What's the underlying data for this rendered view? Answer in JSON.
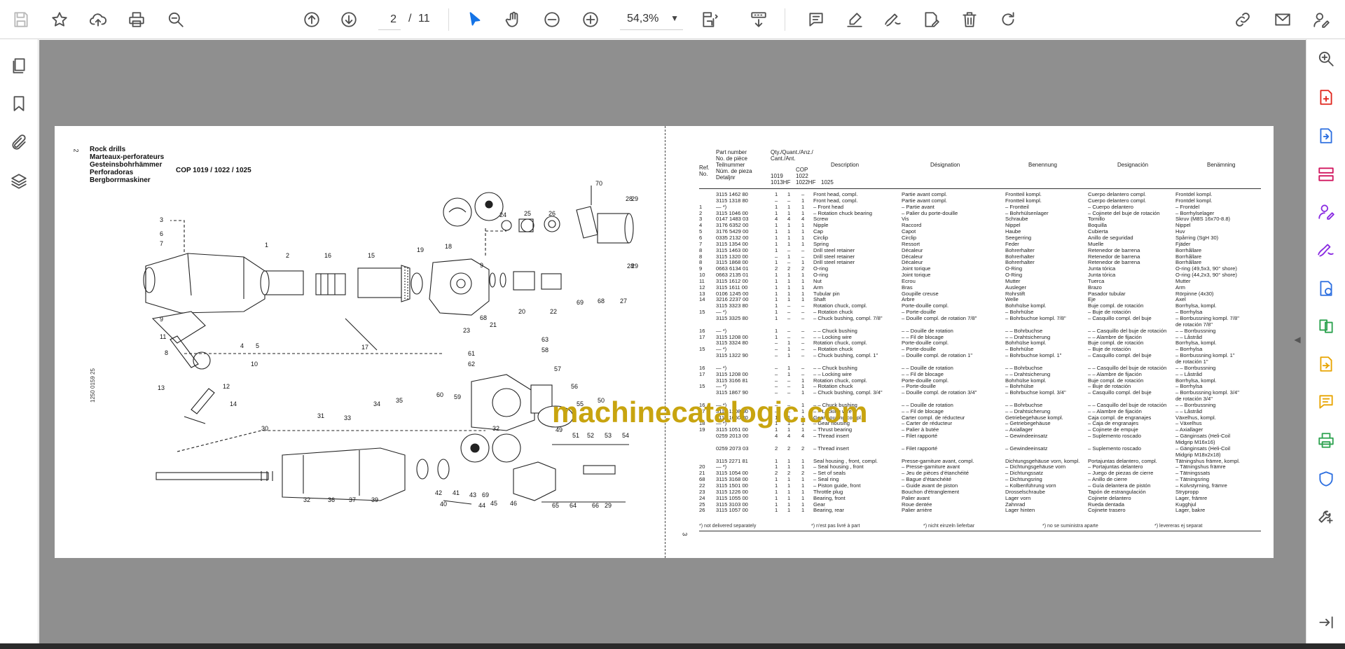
{
  "toolbar": {
    "page_current": "2",
    "page_separator": "/",
    "page_total": "11",
    "zoom": "54,3%",
    "icons": [
      "save-icon",
      "star-icon",
      "upload-icon",
      "print-icon",
      "search-icon",
      "page-up-icon",
      "page-down-icon",
      "select-cursor-icon",
      "hand-tool-icon",
      "zoom-out-icon",
      "zoom-in-icon",
      "page-fit-icon",
      "scroll-mode-icon",
      "comment-icon",
      "highlight-icon",
      "draw-icon",
      "edit-text-icon",
      "delete-icon",
      "redo-icon",
      "share-link-icon",
      "mail-icon",
      "sign-icon"
    ]
  },
  "left_rail": {
    "icons": [
      "pages-icon",
      "bookmark-icon",
      "attachment-icon",
      "layers-icon"
    ]
  },
  "right_rail": {
    "icons": [
      "zoom-search-icon",
      "create-pdf-icon",
      "export-pdf-icon",
      "organize-pages-icon",
      "fill-sign-icon",
      "edit-pdf-icon",
      "convert-icon",
      "compare-icon",
      "export-file-icon",
      "comment-icon",
      "print-production-icon",
      "protect-icon",
      "more-tools-icon",
      "expand-icon"
    ]
  },
  "colors": {
    "accent": "#1473e6",
    "watermark": "#c8a40f",
    "viewer_bg": "#8f8f8f"
  },
  "document": {
    "left_page_number": "2",
    "right_page_number": "3",
    "headings": [
      "Rock drills",
      "Marteaux-perforateurs",
      "Gesteinsbohrhämmer",
      "Perforadoras",
      "Bergborrmaskiner"
    ],
    "model_title": "COP 1019 / 1022 / 1025",
    "figure_code": "1250 0159 25",
    "diagram_labels": [
      "70",
      "28",
      "29",
      "24",
      "25",
      "26",
      "3",
      "6",
      "7",
      "1",
      "2",
      "16",
      "15",
      "19",
      "18",
      "9",
      "68",
      "21",
      "69",
      "68",
      "27",
      "28",
      "29",
      "9",
      "11",
      "4",
      "5",
      "8",
      "10",
      "17",
      "20",
      "22",
      "23",
      "63",
      "61",
      "62",
      "58",
      "57",
      "13",
      "12",
      "14",
      "60",
      "59",
      "56",
      "55",
      "50",
      "31",
      "33",
      "34",
      "35",
      "30",
      "49",
      "51",
      "52",
      "53",
      "54",
      "32",
      "36",
      "37",
      "39",
      "42",
      "41",
      "43",
      "69",
      "44",
      "45",
      "46",
      "65",
      "64",
      "66",
      "29",
      "40",
      "39",
      "38",
      "48",
      "47",
      "67"
    ],
    "watermark": "machinecatalogic.com",
    "table_headers": {
      "ref": "Ref.\nNo.",
      "part": "Part number\nNo. de pièce\nTeilnummer\nNúm. de pieza\nDetaljnr",
      "qty": "Qty./Quant./Anz./\nCant./Ant.",
      "cop": "COP",
      "m1": "1019\n1013HF",
      "m2": "1022\n1022HF",
      "m3": "1025",
      "en": "Description",
      "fr": "Désignation",
      "de": "Benennung",
      "es": "Designación",
      "sv": "Benämning"
    },
    "rows": [
      {
        "ref": "",
        "part": "3115 1462 80",
        "q": [
          "1",
          "1",
          "–"
        ],
        "en": "Front head, compl.",
        "fr": "Partie avant compl.",
        "de": "Frontteil kompl.",
        "es": "Cuerpo delantero compl.",
        "sv": "Frontdel kompl."
      },
      {
        "ref": "",
        "part": "3115 1318 80",
        "q": [
          "–",
          "–",
          "1"
        ],
        "en": "Front head, compl.",
        "fr": "Partie avant compl.",
        "de": "Frontteil kompl.",
        "es": "Cuerpo delantero compl.",
        "sv": "Frontdel kompl."
      },
      {
        "ref": "1",
        "part": "— *)",
        "q": [
          "1",
          "1",
          "1"
        ],
        "en": "– Front head",
        "fr": "– Partie avant",
        "de": "– Frontteil",
        "es": "– Cuerpo delantero",
        "sv": "– Frontdel"
      },
      {
        "ref": "2",
        "part": "3115 1046 00",
        "q": [
          "1",
          "1",
          "1"
        ],
        "en": "– Rotation chuck bearing",
        "fr": "– Palier du porte-douille",
        "de": "– Bohrhülsenlager",
        "es": "– Cojinete del buje de rotación",
        "sv": "– Borrhylselager"
      },
      {
        "ref": "3",
        "part": "0147 1483 03",
        "q": [
          "4",
          "4",
          "4"
        ],
        "en": "Screw",
        "fr": "Vis",
        "de": "Schraube",
        "es": "Tornillo",
        "sv": "Skruv (M8S 16x70-8.8)"
      },
      {
        "ref": "4",
        "part": "3176 6352 00",
        "q": [
          "1",
          "1",
          "1"
        ],
        "en": "Nipple",
        "fr": "Raccord",
        "de": "Nippel",
        "es": "Boquilla",
        "sv": "Nippel"
      },
      {
        "ref": "5",
        "part": "3176 5429 00",
        "q": [
          "1",
          "1",
          "1"
        ],
        "en": "Cap",
        "fr": "Capot",
        "de": "Haube",
        "es": "Cubierta",
        "sv": "Huv"
      },
      {
        "ref": "6",
        "part": "0335 2132 00",
        "q": [
          "1",
          "1",
          "1"
        ],
        "en": "Circlip",
        "fr": "Circlip",
        "de": "Seegerring",
        "es": "Anillo de seguridad",
        "sv": "Spårring (SgH 30)"
      },
      {
        "ref": "7",
        "part": "3115 1354 00",
        "q": [
          "1",
          "1",
          "1"
        ],
        "en": "Spring",
        "fr": "Ressort",
        "de": "Feder",
        "es": "Muelle",
        "sv": "Fjäder"
      },
      {
        "ref": "8",
        "part": "3115 1463 00",
        "q": [
          "1",
          "–",
          "–"
        ],
        "en": "Drill steel retainer",
        "fr": "Décaleur",
        "de": "Bohrerhalter",
        "es": "Retenedor de barrena",
        "sv": "Borrhållare"
      },
      {
        "ref": "8",
        "part": "3115 1320 00",
        "q": [
          "–",
          "1",
          "–"
        ],
        "en": "Drill steel retainer",
        "fr": "Décaleur",
        "de": "Bohrerhalter",
        "es": "Retenedor de barrena",
        "sv": "Borrhållare"
      },
      {
        "ref": "8",
        "part": "3115 1868 00",
        "q": [
          "1",
          "–",
          "1"
        ],
        "en": "Drill steel retainer",
        "fr": "Décaleur",
        "de": "Bohrerhalter",
        "es": "Retenedor de barrena",
        "sv": "Borrhållare"
      },
      {
        "ref": "9",
        "part": "0663 6134 01",
        "q": [
          "2",
          "2",
          "2"
        ],
        "en": "O-ring",
        "fr": "Joint torique",
        "de": "O-Ring",
        "es": "Junta tórica",
        "sv": "O-ring (49,5x3, 90° shore)"
      },
      {
        "ref": "10",
        "part": "0663 2135 01",
        "q": [
          "1",
          "1",
          "1"
        ],
        "en": "O-ring",
        "fr": "Joint torique",
        "de": "O-Ring",
        "es": "Junta tórica",
        "sv": "O-ring (44,2x3, 90° shore)"
      },
      {
        "ref": "11",
        "part": "3115 1612 00",
        "q": [
          "1",
          "1",
          "1"
        ],
        "en": "Nut",
        "fr": "Ecrou",
        "de": "Mutter",
        "es": "Tuerca",
        "sv": "Mutter"
      },
      {
        "ref": "12",
        "part": "3115 1611 00",
        "q": [
          "1",
          "1",
          "1"
        ],
        "en": "Arm",
        "fr": "Bras",
        "de": "Ausleger",
        "es": "Brazo",
        "sv": "Arm"
      },
      {
        "ref": "13",
        "part": "0106 1245 00",
        "q": [
          "1",
          "1",
          "1"
        ],
        "en": "Tubular pin",
        "fr": "Goupille creuse",
        "de": "Rohrstift",
        "es": "Pasador tubular",
        "sv": "Rörpinne (4x30)"
      },
      {
        "ref": "14",
        "part": "3216 2237 00",
        "q": [
          "1",
          "1",
          "1"
        ],
        "en": "Shaft",
        "fr": "Arbre",
        "de": "Welle",
        "es": "Eje",
        "sv": "Axel"
      },
      {
        "ref": "",
        "part": "3115 3323 80",
        "q": [
          "1",
          "–",
          "–"
        ],
        "en": "Rotation chuck, compl.",
        "fr": "Porte-douille compl.",
        "de": "Bohrhülse kompl.",
        "es": "Buje compl. de rotación",
        "sv": "Borrhylsa, kompl."
      },
      {
        "ref": "15",
        "part": "— *)",
        "q": [
          "1",
          "–",
          "–"
        ],
        "en": "– Rotation chuck",
        "fr": "– Porte-douille",
        "de": "– Bohrhülse",
        "es": "– Buje de rotación",
        "sv": "– Borrhylsa"
      },
      {
        "ref": "",
        "part": "3115 3325 80",
        "q": [
          "1",
          "–",
          "–"
        ],
        "en": "– Chuck bushing, compl. 7/8\"",
        "fr": "– Douille compl. de rotation 7/8\"",
        "de": "– Bohrbuchse kompl. 7/8\"",
        "es": "– Casquillo compl. del buje",
        "sv": "– Borrbussning kompl. 7/8\""
      },
      {
        "ref": "",
        "part": "",
        "q": [
          "",
          "",
          ""
        ],
        "en": "",
        "fr": "",
        "de": "",
        "es": "",
        "sv": "de rotación 7/8\""
      },
      {
        "ref": "16",
        "part": "— *)",
        "q": [
          "1",
          "–",
          "–"
        ],
        "en": "– – Chuck bushing",
        "fr": "– – Douille de rotation",
        "de": "– – Bohrbuchse",
        "es": "– – Casquillo del buje de rotación",
        "sv": "– – Borrbussning"
      },
      {
        "ref": "17",
        "part": "3115 1208 00",
        "q": [
          "1",
          "–",
          "–"
        ],
        "en": "– – Locking wire",
        "fr": "– – Fil de blocage",
        "de": "– – Drahtsicherung",
        "es": "– – Alambre de fijación",
        "sv": "– – Låstråd"
      },
      {
        "ref": "",
        "part": "3115 3324 80",
        "q": [
          "–",
          "1",
          "–"
        ],
        "en": "Rotation chuck, compl.",
        "fr": "Porte-douille compl.",
        "de": "Bohrhülse kompl.",
        "es": "Buje compl. de rotación",
        "sv": "Borrhylsa, kompl."
      },
      {
        "ref": "15",
        "part": "— *)",
        "q": [
          "–",
          "1",
          "–"
        ],
        "en": "– Rotation chuck",
        "fr": "– Porte-douille",
        "de": "– Bohrhülse",
        "es": "– Buje de rotación",
        "sv": "– Borrhylsa"
      },
      {
        "ref": "",
        "part": "3115 1322 90",
        "q": [
          "–",
          "1",
          "–"
        ],
        "en": "– Chuck bushing, compl. 1\"",
        "fr": "– Douille compl. de rotation 1\"",
        "de": "– Bohrbuchse kompl. 1\"",
        "es": "– Casquillo compl. del buje",
        "sv": "– Borrbussning kompl. 1\""
      },
      {
        "ref": "",
        "part": "",
        "q": [
          "",
          "",
          ""
        ],
        "en": "",
        "fr": "",
        "de": "",
        "es": "",
        "sv": "de rotación 1\""
      },
      {
        "ref": "16",
        "part": "— *)",
        "q": [
          "–",
          "1",
          "–"
        ],
        "en": "– – Chuck bushing",
        "fr": "– – Douille de rotation",
        "de": "– – Bohrbuchse",
        "es": "– – Casquillo del buje de rotación",
        "sv": "– – Borrbussning"
      },
      {
        "ref": "17",
        "part": "3115 1208 00",
        "q": [
          "–",
          "1",
          "–"
        ],
        "en": "– – Locking wire",
        "fr": "– – Fil de blocage",
        "de": "– – Drahtsicherung",
        "es": "– – Alambre de fijación",
        "sv": "– – Låstråd"
      },
      {
        "ref": "",
        "part": "3115 3166 81",
        "q": [
          "–",
          "–",
          "1"
        ],
        "en": "Rotation chuck, compl.",
        "fr": "Porte-douille compl.",
        "de": "Bohrhülse kompl.",
        "es": "Buje compl. de rotación",
        "sv": "Borrhylsa, kompl."
      },
      {
        "ref": "15",
        "part": "— *)",
        "q": [
          "–",
          "–",
          "1"
        ],
        "en": "– Rotation chuck",
        "fr": "– Porte-douille",
        "de": "– Bohrhülse",
        "es": "– Buje de rotación",
        "sv": "– Borrhylsa"
      },
      {
        "ref": "",
        "part": "3115 1867 90",
        "q": [
          "–",
          "–",
          "1"
        ],
        "en": "– Chuck bushing, compl. 3/4\"",
        "fr": "– Douille compl. de rotation 3/4\"",
        "de": "– Bohrbuchse kompl. 3/4\"",
        "es": "– Casquillo compl. del buje",
        "sv": "– Borrbussning kompl. 3/4\""
      },
      {
        "ref": "",
        "part": "",
        "q": [
          "",
          "",
          ""
        ],
        "en": "",
        "fr": "",
        "de": "",
        "es": "",
        "sv": "de rotación 3/4\""
      },
      {
        "ref": "16",
        "part": "— *)",
        "q": [
          "–",
          "–",
          "1"
        ],
        "en": "– – Chuck bushing",
        "fr": "– – Douille de rotation",
        "de": "– – Bohrbuchse",
        "es": "– – Casquillo del buje de rotación",
        "sv": "– – Borrbussning"
      },
      {
        "ref": "17",
        "part": "3115 1208 00",
        "q": [
          "–",
          "–",
          "1"
        ],
        "en": "– – Locking wire",
        "fr": "– – Fil de blocage",
        "de": "– – Drahtsicherung",
        "es": "– – Alambre de fijación",
        "sv": "– – Låstråd"
      },
      {
        "ref": "",
        "part": "3115 1050 80",
        "q": [
          "1",
          "1",
          "1"
        ],
        "en": "Gear housing compl.",
        "fr": "Carter compl. de réducteur",
        "de": "Getriebegehäuse kompl.",
        "es": "Caja compl. de engranajes",
        "sv": "Växelhus, kompl."
      },
      {
        "ref": "18",
        "part": "— *)",
        "q": [
          "1",
          "1",
          "1"
        ],
        "en": "– Gear housing",
        "fr": "– Carter de réducteur",
        "de": "– Getriebegehäuse",
        "es": "– Caja de engranajes",
        "sv": "– Växelhus"
      },
      {
        "ref": "19",
        "part": "3115 1051 00",
        "q": [
          "1",
          "1",
          "1"
        ],
        "en": "– Thrust bearing",
        "fr": "– Palier à butée",
        "de": "– Axiallager",
        "es": "– Cojinete de empuje",
        "sv": "– Axiallager"
      },
      {
        "ref": "",
        "part": "0259 2013 00",
        "q": [
          "4",
          "4",
          "4"
        ],
        "en": "– Thread insert",
        "fr": "– Filet rapporté",
        "de": "– Gewindeeinsatz",
        "es": "– Suplemento roscado",
        "sv": "– Gänginsats (Heli-Coil"
      },
      {
        "ref": "",
        "part": "",
        "q": [
          "",
          "",
          ""
        ],
        "en": "",
        "fr": "",
        "de": "",
        "es": "",
        "sv": "Midgrip M16x16)"
      },
      {
        "ref": "",
        "part": "0259 2073 03",
        "q": [
          "2",
          "2",
          "2"
        ],
        "en": "– Thread insert",
        "fr": "– Filet rapporté",
        "de": "– Gewindeeinsatz",
        "es": "– Suplemento roscado",
        "sv": "– Gänginsats (Heli-Coil"
      },
      {
        "ref": "",
        "part": "",
        "q": [
          "",
          "",
          ""
        ],
        "en": "",
        "fr": "",
        "de": "",
        "es": "",
        "sv": "Midgrip M18x2x18)"
      },
      {
        "ref": "",
        "part": "3115 2271 81",
        "q": [
          "1",
          "1",
          "1"
        ],
        "en": "Seal housing , front, compl.",
        "fr": "Presse-garniture avant, compl.",
        "de": "Dichtungsgehäuse vorn, kompl.",
        "es": "Portajuntas delantero, compl.",
        "sv": "Tätningshus främre, kompl."
      },
      {
        "ref": "20",
        "part": "— *)",
        "q": [
          "1",
          "1",
          "1"
        ],
        "en": "– Seal housing , front",
        "fr": "– Presse-garniture avant",
        "de": "– Dichtungsgehäuse vorn",
        "es": "– Portajuntas delantero",
        "sv": "– Tätningshus främre"
      },
      {
        "ref": "21",
        "part": "3115 1054 00",
        "q": [
          "2",
          "2",
          "2"
        ],
        "en": "– Set of seals",
        "fr": "– Jeu de pièces d'étanchéité",
        "de": "– Dichtungssatz",
        "es": "– Juego de piezas de cierre",
        "sv": "– Tätningssats"
      },
      {
        "ref": "68",
        "part": "3115 3168 00",
        "q": [
          "1",
          "1",
          "1"
        ],
        "en": "– Seal ring",
        "fr": "– Bague d'étanchéité",
        "de": "– Dichtungsring",
        "es": "– Anillo de cierre",
        "sv": "– Tätningsring"
      },
      {
        "ref": "22",
        "part": "3115 1501 00",
        "q": [
          "1",
          "1",
          "1"
        ],
        "en": "– Piston guide, front",
        "fr": "– Guide avant de piston",
        "de": "– Kolbenführung vorn",
        "es": "– Guía delantera de pistón",
        "sv": "– Kolvstyrning, främre"
      },
      {
        "ref": "23",
        "part": "3115 1226 00",
        "q": [
          "1",
          "1",
          "1"
        ],
        "en": "Throttle plug",
        "fr": "Bouchon d'étranglement",
        "de": "Drosselschraube",
        "es": "Tapón de estrangulación",
        "sv": "Strypropp"
      },
      {
        "ref": "24",
        "part": "3115 1055 00",
        "q": [
          "1",
          "1",
          "1"
        ],
        "en": "Bearing, front",
        "fr": "Palier avant",
        "de": "Lager vorn",
        "es": "Cojinete delantero",
        "sv": "Lager, främre"
      },
      {
        "ref": "25",
        "part": "3115 3103 00",
        "q": [
          "1",
          "1",
          "1"
        ],
        "en": "Gear",
        "fr": "Roue dentée",
        "de": "Zahnrad",
        "es": "Rueda dentada",
        "sv": "Kugghjul"
      },
      {
        "ref": "26",
        "part": "3115 1057 00",
        "q": [
          "1",
          "1",
          "1"
        ],
        "en": "Bearing, rear",
        "fr": "Palier arrière",
        "de": "Lager hinten",
        "es": "Cojinete trasero",
        "sv": "Lager, bakre"
      }
    ],
    "footnotes": [
      "*) not delivered separately",
      "*) n'est pas livré à part",
      "*) nicht einzeln lieferbar",
      "*) no se suministra aparte",
      "*) levereras ej separat"
    ]
  }
}
